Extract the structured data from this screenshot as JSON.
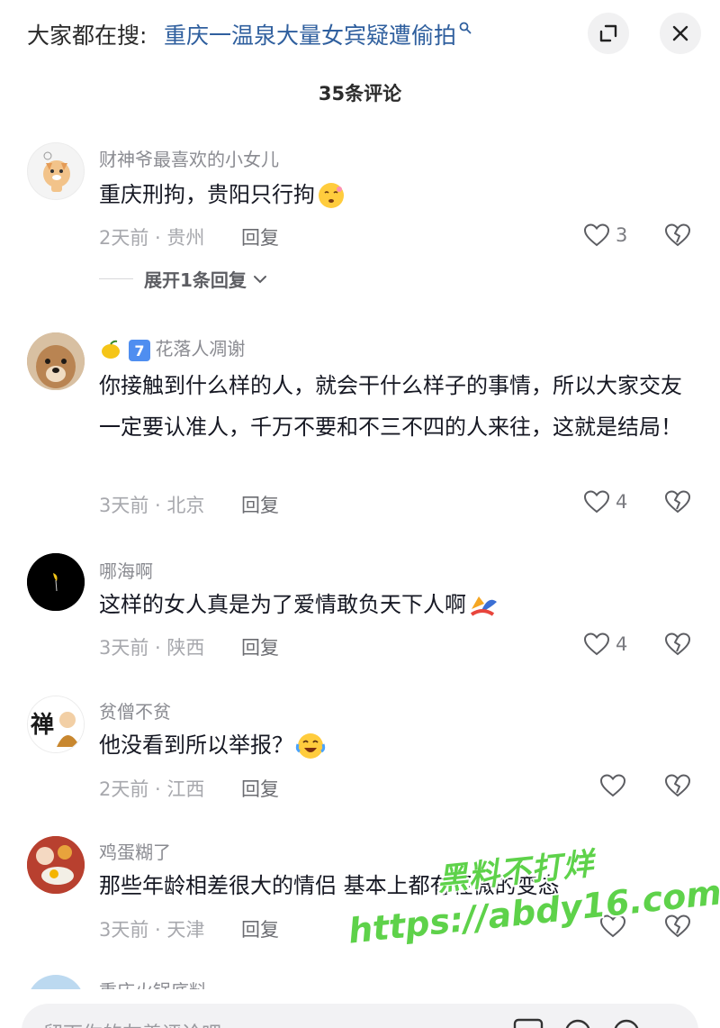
{
  "header": {
    "search_prefix": "大家都在搜:",
    "search_query": "重庆一温泉大量女宾疑遭偷拍",
    "search_icon": "search-icon",
    "expand_icon": "expand-icon",
    "close_icon": "close-icon"
  },
  "comment_count": "35条评论",
  "comments": [
    {
      "username": "财神爷最喜欢的小女儿",
      "text": "重庆刑拘，贵阳只行拘",
      "emoji": "sleepy-face-emoji",
      "meta": "2天前 · 贵州",
      "reply": "回复",
      "likes": "3",
      "expand_replies": "展开1条回复"
    },
    {
      "username": "花落人凋谢",
      "badge_number": "7",
      "text": "你接触到什么样的人，就会干什么样子的事情，所以大家交友一定要认准人，千万不要和不三不四的人来往，这就是结局！",
      "meta": "3天前 · 北京",
      "reply": "回复",
      "likes": "4"
    },
    {
      "username": "哪海啊",
      "text": "这样的女人真是为了爱情敢负天下人啊",
      "emoji": "hug-emoji",
      "meta": "3天前 · 陕西",
      "reply": "回复",
      "likes": "4"
    },
    {
      "username": "贫僧不贫",
      "avatar_text": "禅",
      "text": "他没看到所以举报？",
      "emoji": "crying-laughing-emoji",
      "meta": "2天前 · 江西",
      "reply": "回复",
      "likes": ""
    },
    {
      "username": "鸡蛋糊了",
      "text": "那些年龄相差很大的情侣 基本上都有轻微的变态",
      "meta": "3天前 · 天津",
      "reply": "回复",
      "likes": ""
    },
    {
      "username": "重庆火锅底料"
    }
  ],
  "watermark": {
    "line1": "黑料不打烊",
    "line2": "https://abdy16.com"
  },
  "input": {
    "placeholder": "留下你的友善评论吧"
  }
}
